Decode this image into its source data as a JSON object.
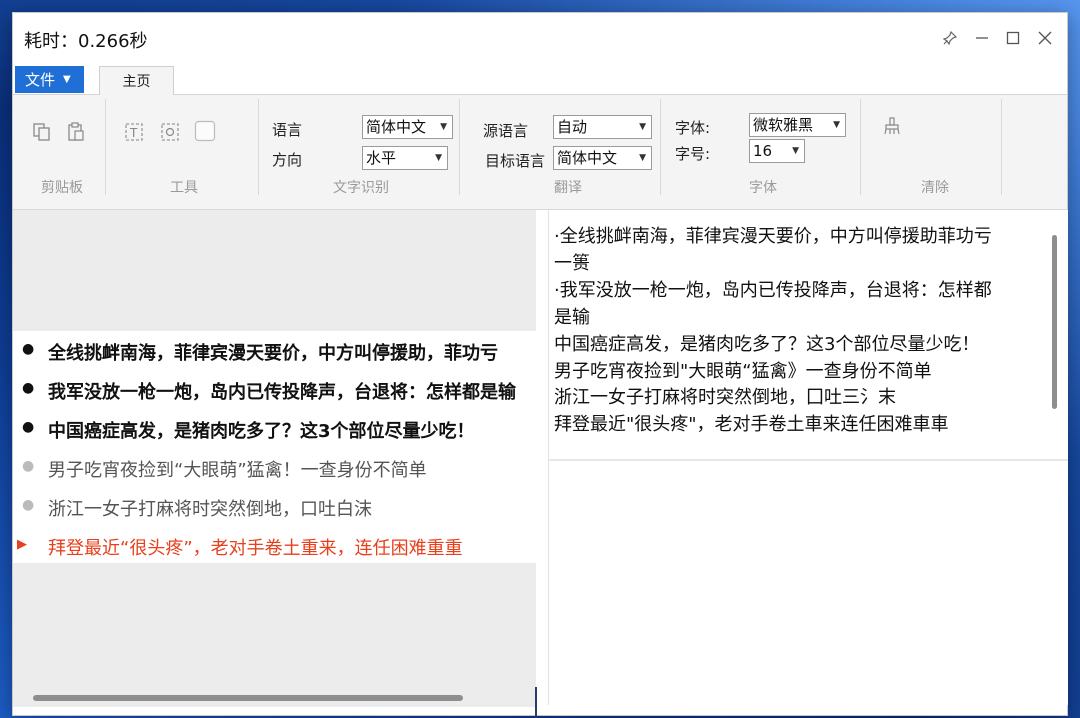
{
  "window": {
    "title": "耗时：0.266秒"
  },
  "menu": {
    "file_label": "文件",
    "home_tab": "主页"
  },
  "ribbon": {
    "groups": {
      "clipboard": "剪贴板",
      "tools": "工具",
      "ocr": "文字识别",
      "translate": "翻译",
      "font": "字体",
      "clear": "清除"
    },
    "ocr": {
      "language_label": "语言",
      "language_value": "简体中文",
      "direction_label": "方向",
      "direction_value": "水平"
    },
    "translate": {
      "source_label": "源语言",
      "source_value": "自动",
      "target_label": "目标语言",
      "target_value": "简体中文"
    },
    "font": {
      "family_label": "字体:",
      "family_value": "微软雅黑",
      "size_label": "字号:",
      "size_value": "16"
    }
  },
  "source_list": [
    "全线挑衅南海，菲律宾漫天要价，中方叫停援助，菲功亏",
    "我军没放一枪一炮，岛内已传投降声，台退将：怎样都是输",
    "中国癌症高发，是猪肉吃多了？这3个部位尽量少吃！",
    "男子吃宵夜捡到“大眼萌”猛禽！一查身份不简单",
    "浙江一女子打麻将时突然倒地，口吐白沫",
    "拜登最近“很头疼”，老对手卷土重来，连任困难重重"
  ],
  "result_lines": [
    "·全线挑衅南海，菲律宾漫天要价，中方叫停援助菲功亏",
    "一篑",
    "·我军没放一枪一炮，岛内已传投降声，台退将：怎样都",
    "是输",
    "中国癌症高发，是猪肉吃多了？这3个部位尽量少吃！",
    "男子吃宵夜捡到\"大眼萌“猛禽》一查身份不简单",
    "浙江一女子打麻将时突然倒地，囗吐三氵末",
    "拜登最近\"很头疼\"，老对手卷土車来连任困难車車"
  ]
}
